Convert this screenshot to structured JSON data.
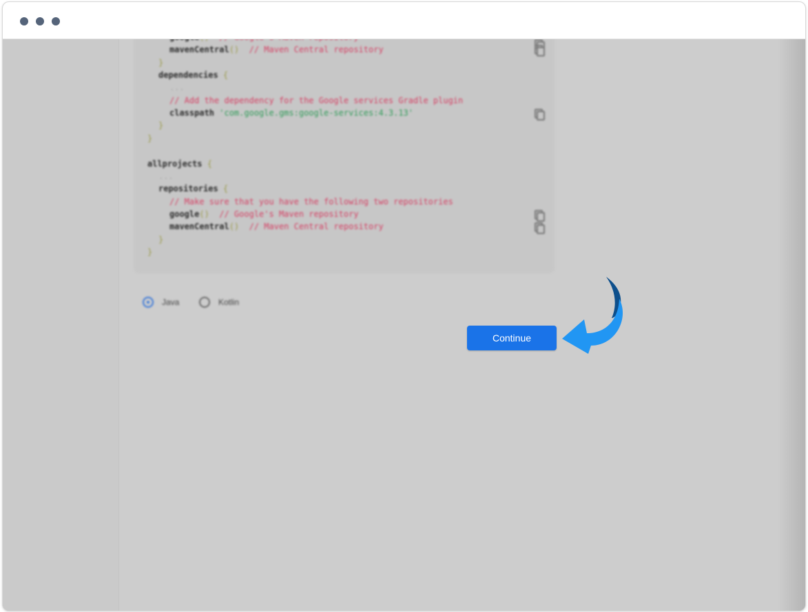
{
  "window": {
    "traffic_dots": 3
  },
  "code": {
    "lines": [
      {
        "indent": 2,
        "parts": [
          [
            "k",
            "google"
          ],
          [
            "b",
            "()"
          ],
          [
            "c",
            "  // Google's Maven repository"
          ]
        ]
      },
      {
        "indent": 2,
        "parts": [
          [
            "k",
            "mavenCentral"
          ],
          [
            "b",
            "()"
          ],
          [
            "c",
            "  // Maven Central repository"
          ]
        ]
      },
      {
        "indent": 1,
        "parts": [
          [
            "b",
            "}"
          ]
        ]
      },
      {
        "indent": 1,
        "parts": [
          [
            "k",
            "dependencies "
          ],
          [
            "b",
            "{"
          ]
        ]
      },
      {
        "indent": 2,
        "parts": [
          [
            "faint",
            "..."
          ]
        ]
      },
      {
        "indent": 2,
        "parts": [
          [
            "c",
            "// Add the dependency for the Google services Gradle plugin"
          ]
        ]
      },
      {
        "indent": 2,
        "parts": [
          [
            "k",
            "classpath "
          ],
          [
            "s",
            "'com.google.gms:google-services:4.3.13'"
          ]
        ]
      },
      {
        "indent": 1,
        "parts": [
          [
            "b",
            "}"
          ]
        ]
      },
      {
        "indent": 0,
        "parts": [
          [
            "b",
            "}"
          ]
        ]
      },
      {
        "indent": 0,
        "parts": []
      },
      {
        "indent": 0,
        "parts": [
          [
            "k",
            "allprojects "
          ],
          [
            "b",
            "{"
          ]
        ]
      },
      {
        "indent": 1,
        "parts": [
          [
            "faint",
            "..."
          ]
        ]
      },
      {
        "indent": 1,
        "parts": [
          [
            "k",
            "repositories "
          ],
          [
            "b",
            "{"
          ]
        ]
      },
      {
        "indent": 2,
        "parts": [
          [
            "c",
            "// Make sure that you have the following two repositories"
          ]
        ]
      },
      {
        "indent": 2,
        "parts": [
          [
            "k",
            "google"
          ],
          [
            "b",
            "()"
          ],
          [
            "c",
            "  // Google's Maven repository"
          ]
        ]
      },
      {
        "indent": 2,
        "parts": [
          [
            "k",
            "mavenCentral"
          ],
          [
            "b",
            "()"
          ],
          [
            "c",
            "  // Maven Central repository"
          ]
        ]
      },
      {
        "indent": 1,
        "parts": [
          [
            "b",
            "}"
          ]
        ]
      },
      {
        "indent": 0,
        "parts": [
          [
            "b",
            "}"
          ]
        ]
      }
    ]
  },
  "language_options": {
    "java_label": "Java",
    "kotlin_label": "Kotlin",
    "selected": "Java"
  },
  "continue_label": "Continue",
  "colors": {
    "accent": "#1a73e8",
    "arrow_light": "#2196f3",
    "arrow_dark": "#0d4f8c"
  }
}
